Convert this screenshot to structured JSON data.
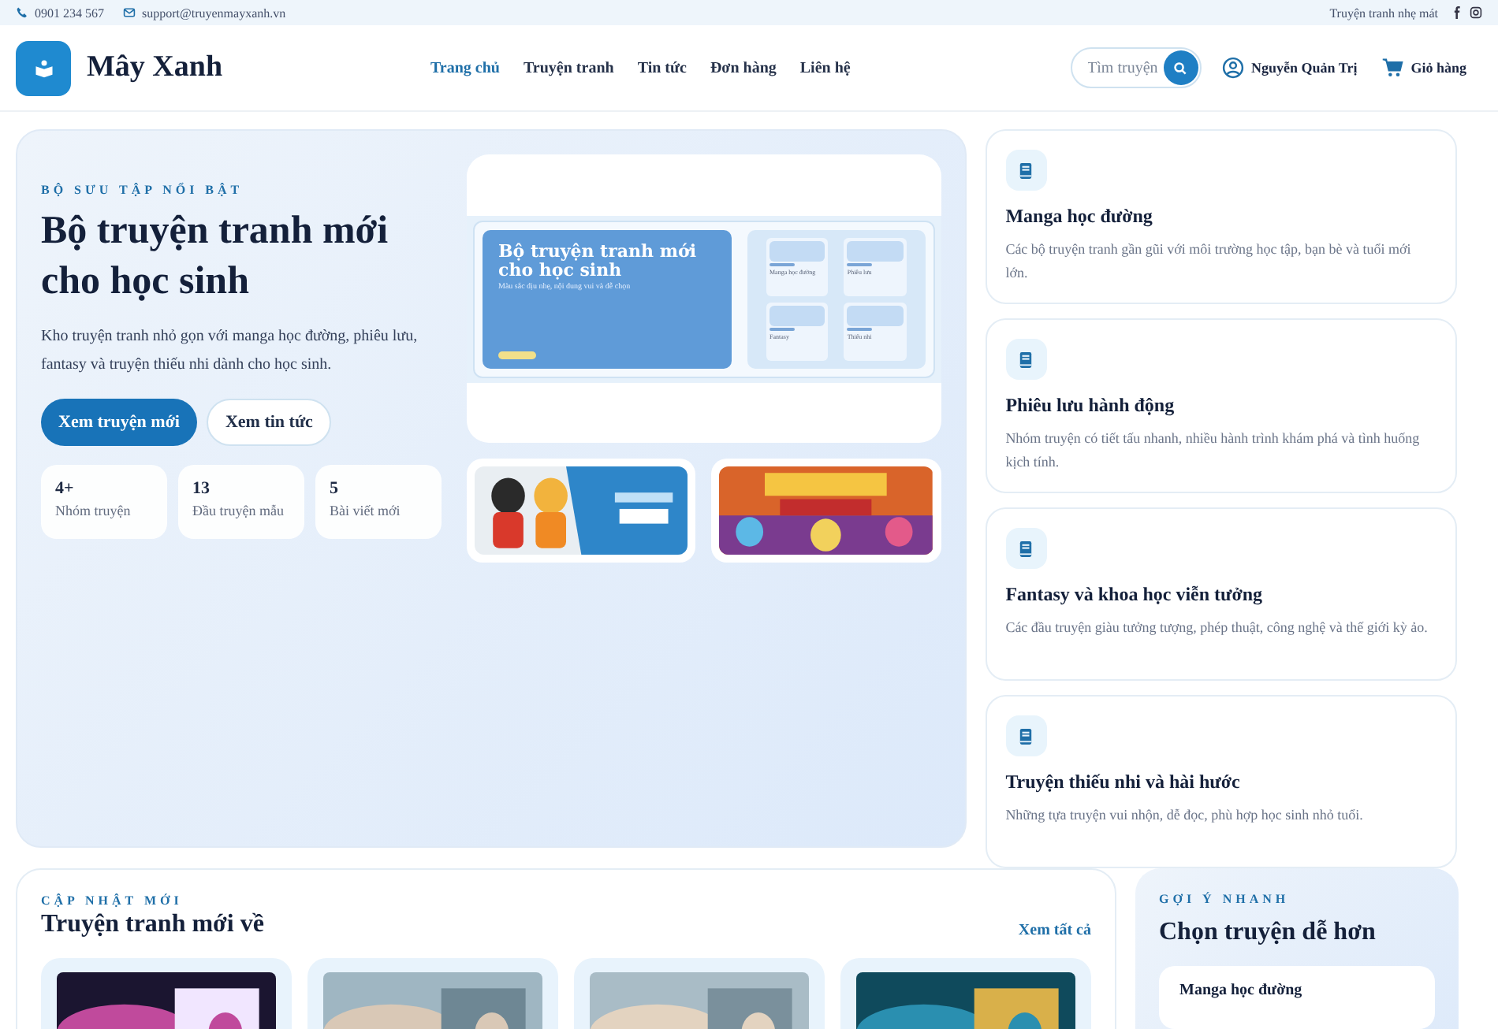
{
  "topbar": {
    "phone": "0901 234 567",
    "email": "support@truyenmayxanh.vn",
    "tagline": "Truyện tranh nhẹ mát"
  },
  "header": {
    "brand": "Mây Xanh",
    "nav": [
      {
        "label": "Trang chủ",
        "selected": true
      },
      {
        "label": "Truyện tranh",
        "selected": false
      },
      {
        "label": "Tin tức",
        "selected": false
      },
      {
        "label": "Đơn hàng",
        "selected": false
      },
      {
        "label": "Liên hệ",
        "selected": false
      }
    ],
    "search": {
      "placeholder": "Tìm truyện"
    },
    "user": "Nguyễn Quản Trị",
    "cart": "Giỏ hàng"
  },
  "hero": {
    "eyebrow": "BỘ SƯU TẬP NỔI BẬT",
    "title": "Bộ truyện tranh mới cho học sinh",
    "description": "Kho truyện tranh nhỏ gọn với manga học đường, phiêu lưu, fantasy và truyện thiếu nhi dành cho học sinh.",
    "buttons": [
      {
        "label": "Xem truyện mới",
        "kind": "primary"
      },
      {
        "label": "Xem tin tức",
        "kind": "outline"
      }
    ],
    "stats": [
      {
        "value": "4+",
        "label": "Nhóm truyện"
      },
      {
        "value": "13",
        "label": "Đầu truyện mẫu"
      },
      {
        "value": "5",
        "label": "Bài viết mới"
      }
    ],
    "mockup": {
      "title": "Bộ truyện tranh mới cho học sinh",
      "subtitle": "Màu sắc dịu nhẹ, nội dung vui và dễ chọn",
      "tiles": [
        "Manga học đường",
        "Phiêu lưu",
        "Fantasy",
        "Thiếu nhi"
      ]
    }
  },
  "categories": [
    {
      "title": "Manga học đường",
      "description": "Các bộ truyện tranh gần gũi với môi trường học tập, bạn bè và tuổi mới lớn."
    },
    {
      "title": "Phiêu lưu hành động",
      "description": "Nhóm truyện có tiết tấu nhanh, nhiều hành trình khám phá và tình huống kịch tính."
    },
    {
      "title": "Fantasy và khoa học viễn tưởng",
      "description": "Các đầu truyện giàu tưởng tượng, phép thuật, công nghệ và thế giới kỳ ảo."
    },
    {
      "title": "Truyện thiếu nhi và hài hước",
      "description": "Những tựa truyện vui nhộn, dễ đọc, phù hợp học sinh nhỏ tuổi."
    }
  ],
  "latest": {
    "eyebrow": "CẬP NHẬT MỚI",
    "title": "Truyện tranh mới về",
    "link": "Xem tất cả"
  },
  "suggest": {
    "eyebrow": "GỢI Ý NHANH",
    "title": "Chọn truyện dễ hơn",
    "items": [
      "Manga học đường"
    ]
  }
}
